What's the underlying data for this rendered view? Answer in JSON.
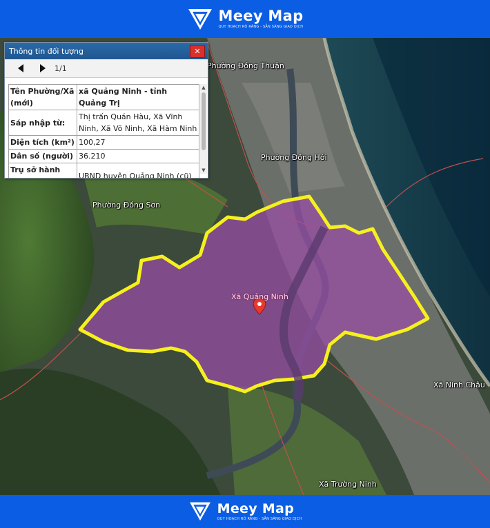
{
  "brand": {
    "name": "Meey Map",
    "tagline": "QUY HOẠCH RÕ RÀNG - SẴN SÀNG GIAO DỊCH"
  },
  "info_panel": {
    "title": "Thông tin đối tượng",
    "close_glyph": "✕",
    "page_indicator": "1/1",
    "rows": [
      {
        "key": "Tên Phường/Xã (mới)",
        "value": "xã Quảng Ninh - tỉnh Quảng Trị"
      },
      {
        "key": "Sáp nhập từ:",
        "value": "Thị trấn Quán Hàu, Xã Vĩnh Ninh, Xã Võ Ninh, Xã Hàm Ninh"
      },
      {
        "key": "Diện tích (km²)",
        "value": "100,27"
      },
      {
        "key": "Dân số (người)",
        "value": "36.210"
      },
      {
        "key": "Trụ sở hành chính (mới)",
        "value": "UBND huyện Quảng Ninh (cũ)"
      }
    ]
  },
  "map": {
    "labels": {
      "dong_thuan": "Phường Đồng Thuận",
      "dong_hoi": "Phường Đồng Hới",
      "dong_son": "Phường Đồng Sơn",
      "quang_ninh": "Xã Quảng Ninh",
      "ninh_chau": "Xã Ninh Châu",
      "truong_ninh": "Xã Trường Ninh"
    },
    "colors": {
      "boundary_highlight": "#f5f01e",
      "selected_fill": "#9a4ea8",
      "admin_border": "#c0504d",
      "marker": "#e8392e",
      "brand_blue": "#0b5ee3"
    },
    "icons": {
      "marker": "map-pin-icon",
      "logo": "meey-logo-icon"
    }
  }
}
